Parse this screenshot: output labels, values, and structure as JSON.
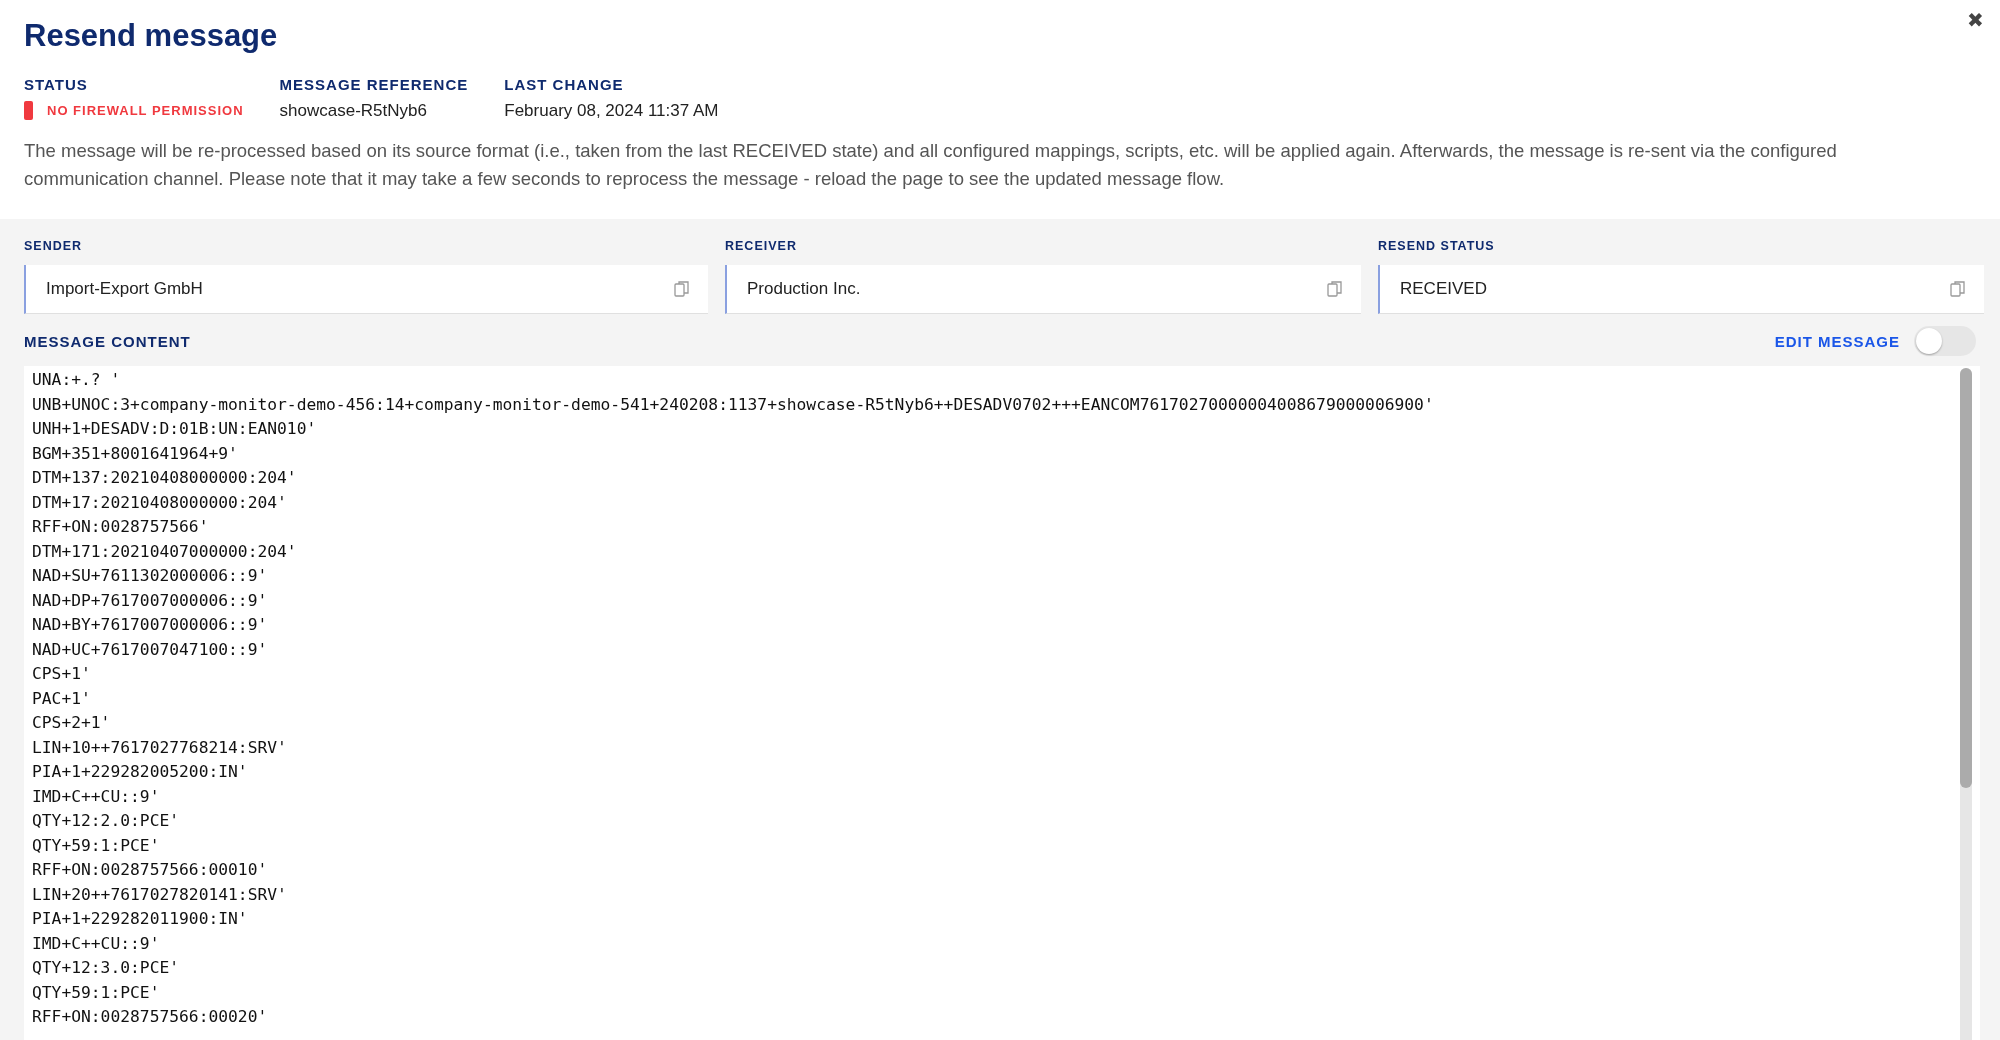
{
  "title": "Resend message",
  "close": "✖",
  "meta": [
    {
      "label": "STATUS",
      "value": "NO FIREWALL PERMISSION",
      "kind": "status",
      "color": "#f0393f"
    },
    {
      "label": "MESSAGE REFERENCE",
      "value": "showcase-R5tNyb6",
      "kind": "text"
    },
    {
      "label": "LAST CHANGE",
      "value": "February 08, 2024  11:37 AM",
      "kind": "text"
    }
  ],
  "description": "The message will be re-processed based on its source format (i.e., taken from the last RECEIVED state) and all configured mappings, scripts, etc. will be applied again. Afterwards, the message is re-sent via the configured communication channel. Please note that it may take a few seconds to reprocess the message - reload the page to see the updated message flow.",
  "fields": [
    {
      "label": "SENDER",
      "value": "Import-Export GmbH"
    },
    {
      "label": "RECEIVER",
      "value": "Production Inc."
    },
    {
      "label": "RESEND STATUS",
      "value": "RECEIVED"
    }
  ],
  "content": {
    "label": "MESSAGE CONTENT",
    "edit_label": "EDIT MESSAGE",
    "edit_on": false,
    "lines": [
      "UNA:+.? '",
      "UNB+UNOC:3+company-monitor-demo-456:14+company-monitor-demo-541+240208:1137+showcase-R5tNyb6++DESADV0702+++EANCOM76170270000004008679000006900'",
      "UNH+1+DESADV:D:01B:UN:EAN010'",
      "BGM+351+8001641964+9'",
      "DTM+137:20210408000000:204'",
      "DTM+17:20210408000000:204'",
      "RFF+ON:0028757566'",
      "DTM+171:20210407000000:204'",
      "NAD+SU+7611302000006::9'",
      "NAD+DP+7617007000006::9'",
      "NAD+BY+7617007000006::9'",
      "NAD+UC+7617007047100::9'",
      "CPS+1'",
      "PAC+1'",
      "CPS+2+1'",
      "LIN+10++7617027768214:SRV'",
      "PIA+1+229282005200:IN'",
      "IMD+C++CU::9'",
      "QTY+12:2.0:PCE'",
      "QTY+59:1:PCE'",
      "RFF+ON:0028757566:00010'",
      "LIN+20++7617027820141:SRV'",
      "PIA+1+229282011900:IN'",
      "IMD+C++CU::9'",
      "QTY+12:3.0:PCE'",
      "QTY+59:1:PCE'",
      "RFF+ON:0028757566:00020'"
    ]
  }
}
